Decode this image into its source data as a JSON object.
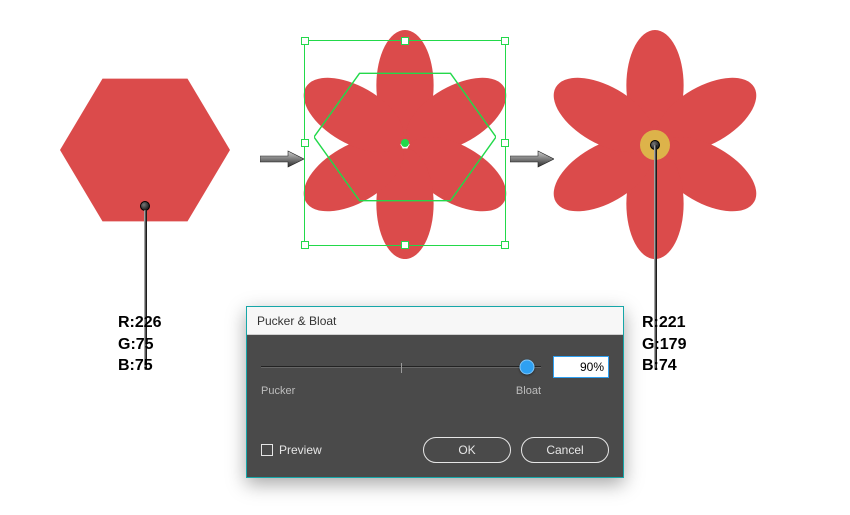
{
  "shapes": {
    "hexagon_fill": "#db4b4b",
    "flower_fill": "#db4b4b",
    "flower_center_fill": "#ddb34a",
    "selection_color": "#22d94a"
  },
  "rgb_left": {
    "r": "R:226",
    "g": "G:75",
    "b": "B:75"
  },
  "rgb_right": {
    "r": "R:221",
    "g": "G:179",
    "b": "B:74"
  },
  "dialog": {
    "title": "Pucker & Bloat",
    "left_label": "Pucker",
    "right_label": "Bloat",
    "value": "90%",
    "preview_label": "Preview",
    "ok_label": "OK",
    "cancel_label": "Cancel"
  }
}
